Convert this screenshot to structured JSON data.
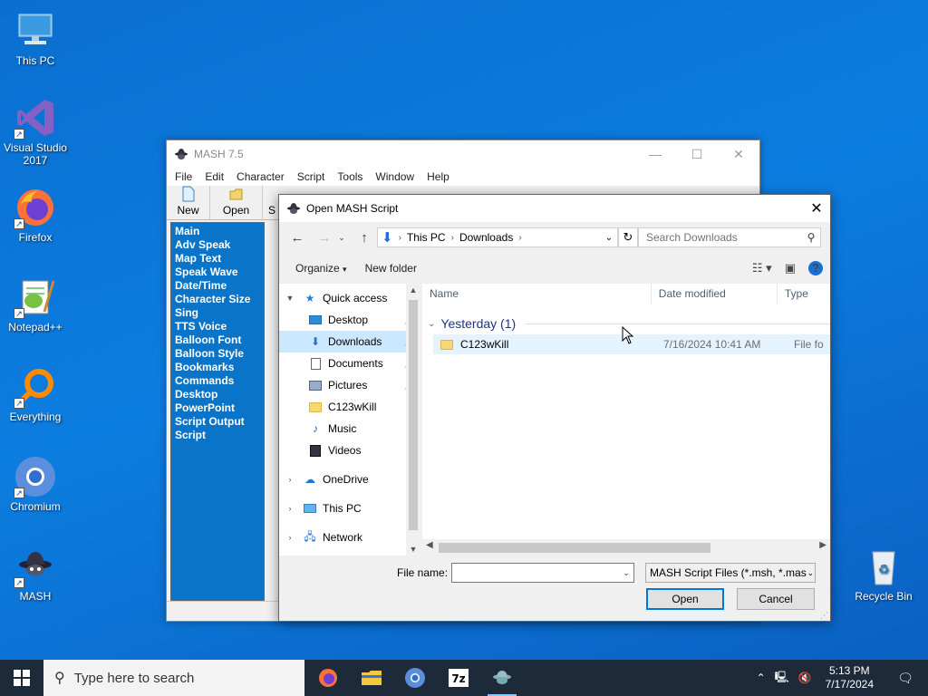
{
  "desktop": {
    "icons": [
      {
        "label": "This PC"
      },
      {
        "label": "Visual Studio 2017"
      },
      {
        "label": "Firefox"
      },
      {
        "label": "Notepad++"
      },
      {
        "label": "Everything"
      },
      {
        "label": "Chromium"
      },
      {
        "label": "MASH"
      },
      {
        "label": "Recycle Bin"
      }
    ]
  },
  "mash": {
    "title": "MASH 7.5",
    "menu": [
      "File",
      "Edit",
      "Character",
      "Script",
      "Tools",
      "Window",
      "Help"
    ],
    "toolbar": {
      "new_label": "New",
      "open_label": "Open",
      "partial_label": "S"
    },
    "side_items": [
      "Main",
      "Adv Speak",
      "Map Text",
      "Speak Wave",
      "Date/Time",
      "Character Size",
      "Sing",
      "TTS Voice",
      "Balloon Font",
      "Balloon Style",
      "Bookmarks",
      "Commands",
      "Desktop",
      "PowerPoint",
      "Script Output",
      "Script"
    ]
  },
  "dialog": {
    "title": "Open MASH Script",
    "close_glyph": "✕",
    "breadcrumb": [
      "This PC",
      "Downloads"
    ],
    "search_placeholder": "Search Downloads",
    "organize_label": "Organize",
    "new_folder_label": "New folder",
    "help_glyph": "?",
    "nav": {
      "quick_access": "Quick access",
      "items": [
        {
          "label": "Desktop",
          "pinned": true
        },
        {
          "label": "Downloads",
          "pinned": true
        },
        {
          "label": "Documents",
          "pinned": true
        },
        {
          "label": "Pictures",
          "pinned": true
        },
        {
          "label": "C123wKill",
          "pinned": false
        },
        {
          "label": "Music",
          "pinned": false
        },
        {
          "label": "Videos",
          "pinned": false
        }
      ],
      "onedrive": "OneDrive",
      "thispc": "This PC",
      "network": "Network"
    },
    "columns": {
      "name": "Name",
      "date": "Date modified",
      "type": "Type"
    },
    "group_label": "Yesterday (1)",
    "files": [
      {
        "name": "C123wKill",
        "date": "7/16/2024 10:41 AM",
        "type": "File fo"
      }
    ],
    "filename_label": "File name:",
    "filename_value": "",
    "filetype_value": "MASH Script Files (*.msh, *.mas",
    "open_label": "Open",
    "cancel_label": "Cancel"
  },
  "taskbar": {
    "search_placeholder": "Type here to search",
    "time": "5:13 PM",
    "date": "7/17/2024"
  }
}
